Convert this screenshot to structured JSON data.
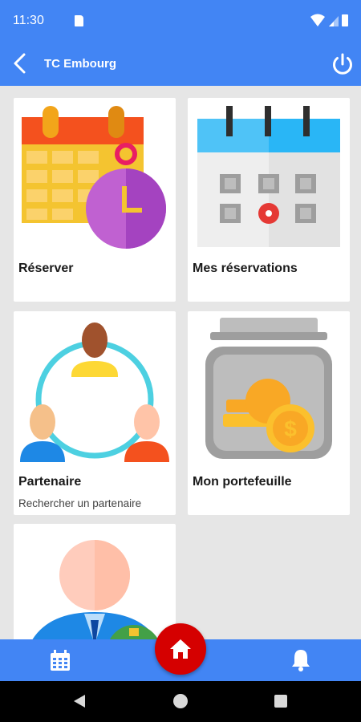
{
  "status_bar": {
    "time": "11:30"
  },
  "app_bar": {
    "title": "TC Embourg"
  },
  "cards": [
    {
      "title": "Réserver",
      "subtitle": ""
    },
    {
      "title": "Mes réservations",
      "subtitle": ""
    },
    {
      "title": "Partenaire",
      "subtitle": "Rechercher un partenaire"
    },
    {
      "title": "Mon portefeuille",
      "subtitle": ""
    },
    {
      "title": "",
      "subtitle": ""
    }
  ],
  "colors": {
    "primary": "#4285f4",
    "fab": "#d50000",
    "background": "#e6e6e6"
  },
  "icons": {
    "back": "arrow-back-icon",
    "power": "power-icon",
    "nav_calendar": "calendar-icon",
    "nav_home": "home-icon",
    "nav_bell": "bell-icon"
  }
}
